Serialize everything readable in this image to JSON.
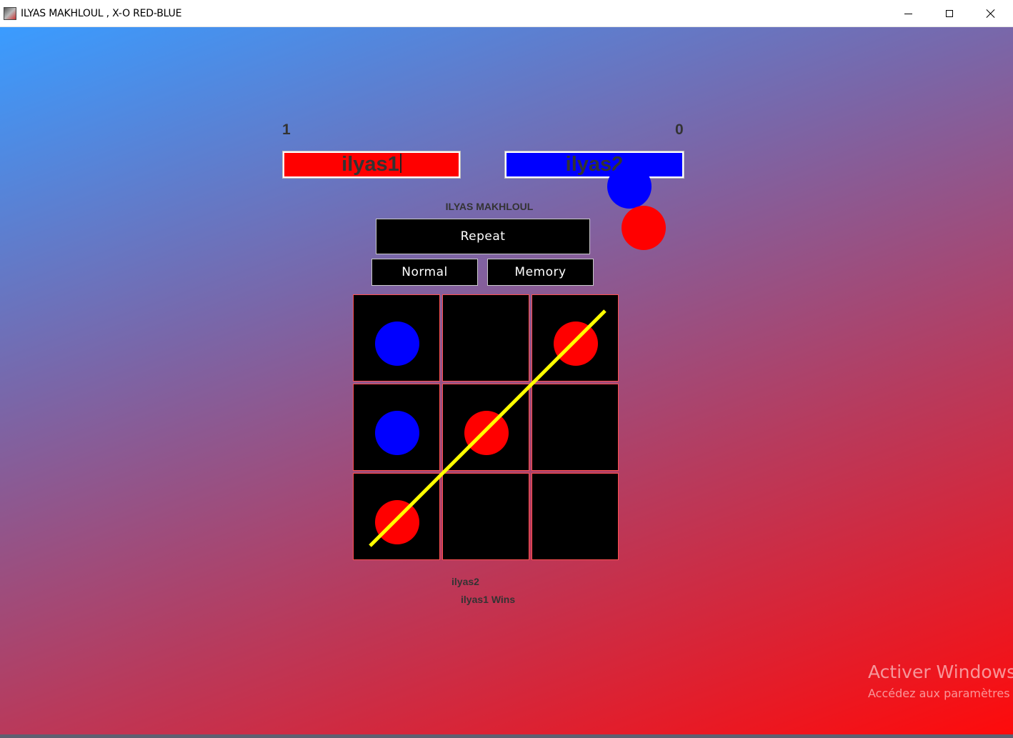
{
  "window": {
    "title": "ILYAS MAKHLOUL , X-O RED-BLUE",
    "icon": "app-icon",
    "controls": [
      "minimize-icon",
      "maximize-icon",
      "close-icon"
    ]
  },
  "scores": {
    "player1": "1",
    "player2": "0"
  },
  "players": {
    "player1": {
      "name": "ilyas1",
      "color": "#ff0000"
    },
    "player2": {
      "name": "ilyas2",
      "color": "#0000ff"
    }
  },
  "author_label": "ILYAS MAKHLOUL",
  "buttons": {
    "repeat": "Repeat",
    "normal": "Normal",
    "memory": "Memory"
  },
  "board": {
    "cells": [
      [
        "blue",
        "",
        "red"
      ],
      [
        "blue",
        "red",
        ""
      ],
      [
        "red",
        "",
        ""
      ]
    ],
    "winning_line": "anti-diagonal",
    "line_color": "#ffff00",
    "cell_color": "#000000",
    "grid_color": "#ff5050"
  },
  "status": {
    "turn": "ilyas2",
    "result": "ilyas1 Wins"
  },
  "watermark": {
    "title": "Activer Windows",
    "subtitle": "Accédez aux paramètres p"
  }
}
